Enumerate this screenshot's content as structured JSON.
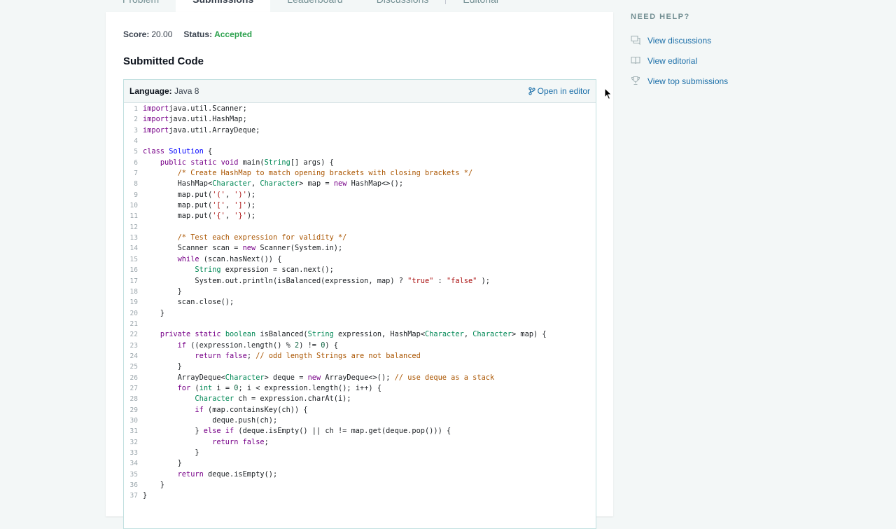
{
  "tabs": [
    {
      "label": "Problem"
    },
    {
      "label": "Submissions"
    },
    {
      "label": "Leaderboard"
    },
    {
      "label": "Discussions"
    },
    {
      "label": "Editorial"
    }
  ],
  "summary": {
    "score_label": "Score:",
    "score_value": "20.00",
    "status_label": "Status:",
    "status_value": "Accepted"
  },
  "colors": {
    "accepted": "#2ea24f",
    "link": "#1a6ea8"
  },
  "section_title": "Submitted Code",
  "code_header": {
    "language_label": "Language:",
    "language_value": "Java 8",
    "open_editor_label": "Open in editor",
    "open_editor_icon": "branch-icon"
  },
  "code_lines": [
    [
      [
        "k",
        "import"
      ],
      [
        "",
        "java.util.Scanner;"
      ]
    ],
    [
      [
        "k",
        "import"
      ],
      [
        "",
        "java.util.HashMap;"
      ]
    ],
    [
      [
        "k",
        "import"
      ],
      [
        "",
        "java.util.ArrayDeque;"
      ]
    ],
    [],
    [
      [
        "k",
        "class"
      ],
      [
        "",
        " "
      ],
      [
        "cl",
        "Solution"
      ],
      [
        "",
        " {"
      ]
    ],
    [
      [
        "",
        "    "
      ],
      [
        "k",
        "public static void"
      ],
      [
        "",
        " main("
      ],
      [
        "t",
        "String"
      ],
      [
        "",
        "[] args) {"
      ]
    ],
    [
      [
        "",
        "        "
      ],
      [
        "c",
        "/* Create HashMap to match opening brackets with closing brackets */"
      ]
    ],
    [
      [
        "",
        "        HashMap<"
      ],
      [
        "t",
        "Character"
      ],
      [
        "",
        ", "
      ],
      [
        "t",
        "Character"
      ],
      [
        "",
        "> map = "
      ],
      [
        "k",
        "new"
      ],
      [
        "",
        " HashMap<>();"
      ]
    ],
    [
      [
        "",
        "        map.put("
      ],
      [
        "s",
        "'('"
      ],
      [
        "",
        ", "
      ],
      [
        "s",
        "')'"
      ],
      [
        "",
        ");"
      ]
    ],
    [
      [
        "",
        "        map.put("
      ],
      [
        "s",
        "'['"
      ],
      [
        "",
        ", "
      ],
      [
        "s",
        "']'"
      ],
      [
        "",
        ");"
      ]
    ],
    [
      [
        "",
        "        map.put("
      ],
      [
        "s",
        "'{'"
      ],
      [
        "",
        ", "
      ],
      [
        "s",
        "'}'"
      ],
      [
        "",
        ");"
      ]
    ],
    [],
    [
      [
        "",
        "        "
      ],
      [
        "c",
        "/* Test each expression for validity */"
      ]
    ],
    [
      [
        "",
        "        Scanner scan = "
      ],
      [
        "k",
        "new"
      ],
      [
        "",
        " Scanner(System.in);"
      ]
    ],
    [
      [
        "",
        "        "
      ],
      [
        "k",
        "while"
      ],
      [
        "",
        " (scan.hasNext()) {"
      ]
    ],
    [
      [
        "",
        "            "
      ],
      [
        "t",
        "String"
      ],
      [
        "",
        " expression = scan.next();"
      ]
    ],
    [
      [
        "",
        "            System.out.println(isBalanced(expression, map) ? "
      ],
      [
        "s",
        "\"true\""
      ],
      [
        "",
        " : "
      ],
      [
        "s",
        "\"false\""
      ],
      [
        "",
        " );"
      ]
    ],
    [
      [
        "",
        "        }"
      ]
    ],
    [
      [
        "",
        "        scan.close();"
      ]
    ],
    [
      [
        "",
        "    }"
      ]
    ],
    [],
    [
      [
        "",
        "    "
      ],
      [
        "k",
        "private static"
      ],
      [
        "",
        " "
      ],
      [
        "t",
        "boolean"
      ],
      [
        "",
        " isBalanced("
      ],
      [
        "t",
        "String"
      ],
      [
        "",
        " expression, HashMap<"
      ],
      [
        "t",
        "Character"
      ],
      [
        "",
        ", "
      ],
      [
        "t",
        "Character"
      ],
      [
        "",
        "> map) {"
      ]
    ],
    [
      [
        "",
        "        "
      ],
      [
        "k",
        "if"
      ],
      [
        "",
        " ((expression.length() % "
      ],
      [
        "n",
        "2"
      ],
      [
        "",
        ") != "
      ],
      [
        "n",
        "0"
      ],
      [
        "",
        ") {"
      ]
    ],
    [
      [
        "",
        "            "
      ],
      [
        "k",
        "return false"
      ],
      [
        "",
        "; "
      ],
      [
        "c",
        "// odd length Strings are not balanced"
      ]
    ],
    [
      [
        "",
        "        }"
      ]
    ],
    [
      [
        "",
        "        ArrayDeque<"
      ],
      [
        "t",
        "Character"
      ],
      [
        "",
        "> deque = "
      ],
      [
        "k",
        "new"
      ],
      [
        "",
        " ArrayDeque<>(); "
      ],
      [
        "c",
        "// use deque as a stack"
      ]
    ],
    [
      [
        "",
        "        "
      ],
      [
        "k",
        "for"
      ],
      [
        "",
        " ("
      ],
      [
        "t",
        "int"
      ],
      [
        "",
        " i = "
      ],
      [
        "n",
        "0"
      ],
      [
        "",
        "; i < expression.length(); i++) {"
      ]
    ],
    [
      [
        "",
        "            "
      ],
      [
        "t",
        "Character"
      ],
      [
        "",
        " ch = expression.charAt(i);"
      ]
    ],
    [
      [
        "",
        "            "
      ],
      [
        "k",
        "if"
      ],
      [
        "",
        " (map.containsKey(ch)) {"
      ]
    ],
    [
      [
        "",
        "                deque.push(ch);"
      ]
    ],
    [
      [
        "",
        "            } "
      ],
      [
        "k",
        "else if"
      ],
      [
        "",
        " (deque.isEmpty() || ch != map.get(deque.pop())) {"
      ]
    ],
    [
      [
        "",
        "                "
      ],
      [
        "k",
        "return false"
      ],
      [
        "",
        ";"
      ]
    ],
    [
      [
        "",
        "            }"
      ]
    ],
    [
      [
        "",
        "        }"
      ]
    ],
    [
      [
        "",
        "        "
      ],
      [
        "k",
        "return"
      ],
      [
        "",
        " deque.isEmpty();"
      ]
    ],
    [
      [
        "",
        "    }"
      ]
    ],
    [
      [
        "",
        "}"
      ]
    ]
  ],
  "help": {
    "title": "NEED HELP?",
    "items": [
      {
        "label": "View discussions",
        "icon": "discussion-icon"
      },
      {
        "label": "View editorial",
        "icon": "book-icon"
      },
      {
        "label": "View top submissions",
        "icon": "trophy-icon"
      }
    ]
  }
}
